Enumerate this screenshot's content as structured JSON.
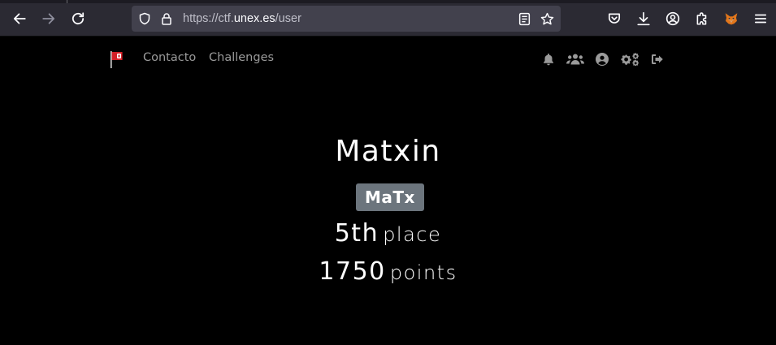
{
  "browser": {
    "url_prefix": "https://ctf.",
    "url_host": "unex.es",
    "url_path": "/user"
  },
  "navbar": {
    "links": [
      "Contacto",
      "Challenges"
    ],
    "icons": [
      "bell-icon",
      "users-icon",
      "user-circle-icon",
      "cogs-icon",
      "sign-out-icon"
    ]
  },
  "profile": {
    "name": "Matxin",
    "team": "MaTx",
    "place_value": "5th",
    "place_label": "place",
    "points_value": "1750",
    "points_label": "points"
  },
  "colors": {
    "background": "#000000",
    "badge": "#6c757d",
    "nav_link": "#9a9a9a"
  }
}
